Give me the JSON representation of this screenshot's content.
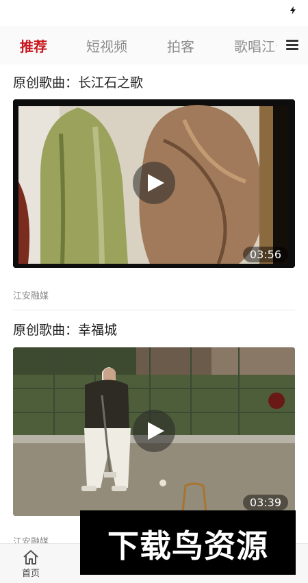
{
  "tabs": [
    {
      "label": "推荐",
      "active": true
    },
    {
      "label": "短视频",
      "active": false
    },
    {
      "label": "拍客",
      "active": false
    },
    {
      "label": "歌唱江安",
      "active": false
    }
  ],
  "feed": [
    {
      "title": "原创歌曲：长江石之歌",
      "duration": "03:56",
      "source": "江安融媒"
    },
    {
      "title": "原创歌曲：幸福城",
      "duration": "03:39",
      "source": "江安融媒"
    }
  ],
  "bottom_nav": [
    {
      "label": "首页",
      "icon": "home-icon"
    },
    {
      "label": "",
      "icon": "nav-icon"
    },
    {
      "label": "",
      "icon": "nav-icon"
    },
    {
      "label": "",
      "icon": "nav-icon"
    },
    {
      "label": "",
      "icon": "nav-icon"
    }
  ],
  "watermark": {
    "text": "下载鸟资源"
  },
  "colors": {
    "accent": "#c8161d",
    "inactive_tab": "#8e8e8e"
  }
}
